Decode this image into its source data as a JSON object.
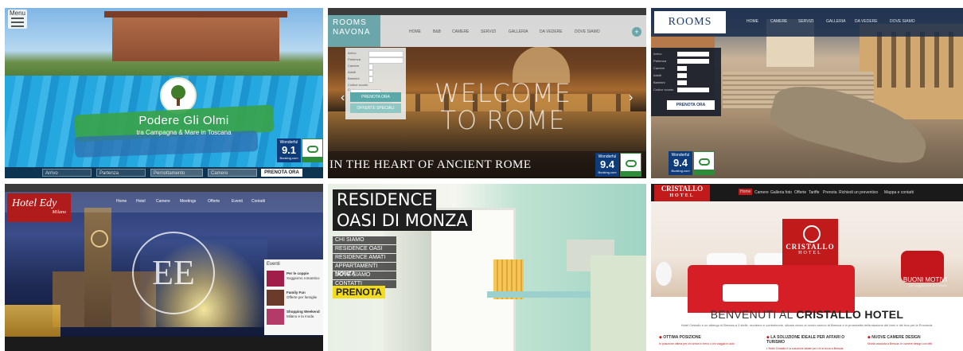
{
  "tile1": {
    "menu_label": "Menu",
    "brand": "Podere Gli Olmi",
    "tagline": "tra Campagna & Mare in Toscana",
    "fields": [
      "Arrivo",
      "Partenza",
      "Pernottamento",
      "Camere"
    ],
    "button": "PRENOTA ORA",
    "rating_label": "Wonderful",
    "rating": "9.1",
    "rating_source": "Booking.com"
  },
  "tile2": {
    "logo_line1": "ROOMS",
    "logo_line2": "NAVONA",
    "nav": [
      "HOME",
      "B&B",
      "CAMERE",
      "SERVIZI",
      "GALLERIA",
      "DA VEDERE",
      "DOVE SIAMO"
    ],
    "form_rows": [
      "Arrivo",
      "Partenza",
      "Camere",
      "Adulti",
      "Bambini",
      "Codice sconto",
      "Carta"
    ],
    "book_button": "PRENOTA ORA",
    "offers_button": "OFFERTE SPECIALI",
    "welcome_line1": "WELCOME",
    "welcome_line2": "TO ROME",
    "subtitle": "IN THE HEART OF ANCIENT ROME",
    "rating_label": "Wonderful",
    "rating": "9.4",
    "rating_source": "Booking.com"
  },
  "tile3": {
    "logo": "ROOMS",
    "nav": [
      "HOME",
      "CAMERE",
      "SERVIZI",
      "GALLERIA",
      "DA VEDERE",
      "DOVE SIAMO"
    ],
    "form_rows": [
      "Arrivo",
      "Partenza",
      "Camere",
      "Adulti",
      "Bambini",
      "Codice sconto"
    ],
    "book_button": "PRENOTA ORA",
    "rating_label": "Wonderful",
    "rating": "9.4",
    "rating_source": "Booking.com"
  },
  "tile4": {
    "logo": "Hotel Edy",
    "logo_sub": "Milano",
    "nav": [
      "Home",
      "Hotel",
      "Camere",
      "Meetings",
      "Offerte",
      "Eventi",
      "Contatti"
    ],
    "monogram": "EE",
    "events_title": "Eventi",
    "events": [
      {
        "title": "Per le coppie",
        "desc": "Soggiorno romantico"
      },
      {
        "title": "Family Fun",
        "desc": "Offerte per famiglie"
      },
      {
        "title": "Shopping Weekend",
        "desc": "Milano e la moda"
      }
    ]
  },
  "tile5": {
    "title_line1": "RESIDENCE",
    "title_line2": "OASI DI MONZA",
    "menu": [
      "CHI SIAMO",
      "RESIDENCE OASI",
      "RESIDENCE AMATI",
      "APPARTAMENTI MONZA",
      "DOVE SIAMO",
      "CONTATTI"
    ],
    "cta": "PRENOTA"
  },
  "tile6": {
    "logo_line1": "CRISTALLO",
    "logo_line2": "HOTEL",
    "nav": [
      "Home",
      "Camere",
      "Galleria foto",
      "Offerte",
      "Tariffe",
      "Prenota",
      "Richiedi un preventivo",
      "Mappa e contatti"
    ],
    "sign_line1": "CRISTALLO",
    "sign_line2": "HOTEL",
    "promo_title": "BUONI MOTIVI",
    "promo_sub": "per soggiornare al Cristallo",
    "welcome_prefix": "BENVENUTI AL",
    "welcome_name": "CRISTALLO HOTEL",
    "intro": "Hotel Cristallo è un albergo di Brescia a 3 stelle, moderno e confortevole, situato vicino al centro storico di Brescia e in prossimità della stazione dei treni e dei bus per la Provincia.",
    "columns": [
      {
        "title": "OTTIMA POSIZIONE",
        "sub": "In posizione ottima per chi arriva in treno o chi viaggia in auto"
      },
      {
        "title": "LA SOLUZIONE IDEALE PER AFFARI O TURISMO",
        "sub": "L'Hotel Cristallo è la soluzione ideale per chi si trova a Brescia"
      },
      {
        "title": "NUOVE CAMERE DESIGN",
        "sub": "Novità assoluta a Brescia, le camere design con letti"
      }
    ]
  }
}
